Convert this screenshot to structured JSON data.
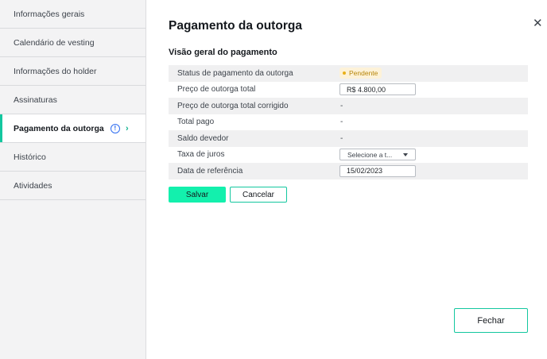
{
  "sidebar": {
    "items": [
      {
        "label": "Informações gerais"
      },
      {
        "label": "Calendário de vesting"
      },
      {
        "label": "Informações do holder"
      },
      {
        "label": "Assinaturas"
      },
      {
        "label": "Pagamento da outorga",
        "active": true
      },
      {
        "label": "Histórico"
      },
      {
        "label": "Atividades"
      }
    ],
    "info_icon": "!",
    "chevron_icon": "›"
  },
  "dialog": {
    "title": "Pagamento da outorga",
    "close_icon": "✕",
    "section_title": "Visão geral do pagamento",
    "rows": {
      "status": {
        "label": "Status de pagamento da outorga",
        "badge": "Pendente"
      },
      "price": {
        "label": "Preço de outorga total",
        "value": "R$ 4.800,00"
      },
      "price_corrected": {
        "label": "Preço de outorga total corrigido",
        "value": "-"
      },
      "total_paid": {
        "label": "Total pago",
        "value": "-"
      },
      "balance": {
        "label": "Saldo devedor",
        "value": "-"
      },
      "interest": {
        "label": "Taxa de juros",
        "select_value": "Selecione a t..."
      },
      "ref_date": {
        "label": "Data de referência",
        "value": "15/02/2023"
      }
    },
    "save_label": "Salvar",
    "cancel_label": "Cancelar",
    "close_label": "Fechar"
  },
  "colors": {
    "accent": "#13f0ad",
    "accent_border": "#13c79f",
    "pending_bg": "#fdf2d8",
    "pending_text": "#b7860b",
    "info": "#2f6df0"
  }
}
